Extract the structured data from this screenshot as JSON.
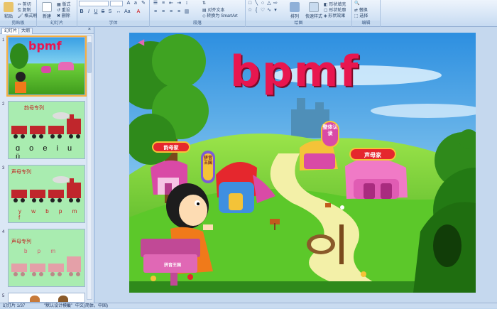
{
  "ribbon": {
    "clipboard": {
      "label": "剪贴板",
      "paste": "粘贴",
      "cut": "剪切",
      "copy": "复制",
      "painter": "格式刷"
    },
    "slides": {
      "label": "幻灯片",
      "new_slide": "新建",
      "layout": "版式",
      "reset": "重设",
      "delete": "删除"
    },
    "font": {
      "label": "字体"
    },
    "paragraph": {
      "label": "段落",
      "align_text": "对齐文本",
      "convert_smartart": "转换为 SmartArt"
    },
    "drawing": {
      "label": "绘图",
      "arrange": "排列",
      "quick_styles": "快速样式",
      "shape_fill": "形状填充",
      "shape_outline": "形状轮廓",
      "shape_effects": "形状效果"
    },
    "editing": {
      "label": "编辑",
      "replace": "替换",
      "select": "选择"
    }
  },
  "leftpane": {
    "tabs": [
      "幻灯片",
      "大纲"
    ],
    "close": "×",
    "thumbs": [
      {
        "num": "1",
        "title": "bpmf"
      },
      {
        "num": "2",
        "title": "韵母专列",
        "letters": "ɑ o e i u ü"
      },
      {
        "num": "3",
        "title": "声母专列",
        "letters": "y w b p m f"
      },
      {
        "num": "4",
        "title": "声母专列",
        "letters": "b p m"
      },
      {
        "num": "5",
        "title": ""
      }
    ]
  },
  "slide": {
    "title": "bpmf",
    "signs": {
      "left_house": "韵母家",
      "center": "整体认读",
      "right_house": "声母家",
      "vertical": "拼音王国",
      "post": "拼音王国"
    }
  },
  "status": {
    "slide_info": "幻灯片 1/37",
    "theme": "\"默认设计模板\"",
    "language": "中文(简体，中国)"
  },
  "colors": {
    "ribbon_bg": "#d6e5f6",
    "title_pink": "#e8164f",
    "sky": "#3aa0e4",
    "grass": "#6fd23a",
    "selected_outline": "#f5b042"
  }
}
